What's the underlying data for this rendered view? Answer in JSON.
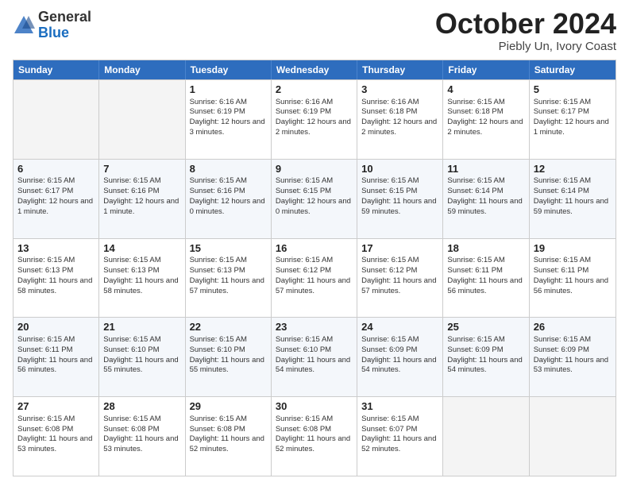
{
  "header": {
    "logo_line1": "General",
    "logo_line2": "Blue",
    "month": "October 2024",
    "location": "Piebly Un, Ivory Coast"
  },
  "days_of_week": [
    "Sunday",
    "Monday",
    "Tuesday",
    "Wednesday",
    "Thursday",
    "Friday",
    "Saturday"
  ],
  "weeks": [
    [
      {
        "day": "",
        "info": ""
      },
      {
        "day": "",
        "info": ""
      },
      {
        "day": "1",
        "info": "Sunrise: 6:16 AM\nSunset: 6:19 PM\nDaylight: 12 hours and 3 minutes."
      },
      {
        "day": "2",
        "info": "Sunrise: 6:16 AM\nSunset: 6:19 PM\nDaylight: 12 hours and 2 minutes."
      },
      {
        "day": "3",
        "info": "Sunrise: 6:16 AM\nSunset: 6:18 PM\nDaylight: 12 hours and 2 minutes."
      },
      {
        "day": "4",
        "info": "Sunrise: 6:15 AM\nSunset: 6:18 PM\nDaylight: 12 hours and 2 minutes."
      },
      {
        "day": "5",
        "info": "Sunrise: 6:15 AM\nSunset: 6:17 PM\nDaylight: 12 hours and 1 minute."
      }
    ],
    [
      {
        "day": "6",
        "info": "Sunrise: 6:15 AM\nSunset: 6:17 PM\nDaylight: 12 hours and 1 minute."
      },
      {
        "day": "7",
        "info": "Sunrise: 6:15 AM\nSunset: 6:16 PM\nDaylight: 12 hours and 1 minute."
      },
      {
        "day": "8",
        "info": "Sunrise: 6:15 AM\nSunset: 6:16 PM\nDaylight: 12 hours and 0 minutes."
      },
      {
        "day": "9",
        "info": "Sunrise: 6:15 AM\nSunset: 6:15 PM\nDaylight: 12 hours and 0 minutes."
      },
      {
        "day": "10",
        "info": "Sunrise: 6:15 AM\nSunset: 6:15 PM\nDaylight: 11 hours and 59 minutes."
      },
      {
        "day": "11",
        "info": "Sunrise: 6:15 AM\nSunset: 6:14 PM\nDaylight: 11 hours and 59 minutes."
      },
      {
        "day": "12",
        "info": "Sunrise: 6:15 AM\nSunset: 6:14 PM\nDaylight: 11 hours and 59 minutes."
      }
    ],
    [
      {
        "day": "13",
        "info": "Sunrise: 6:15 AM\nSunset: 6:13 PM\nDaylight: 11 hours and 58 minutes."
      },
      {
        "day": "14",
        "info": "Sunrise: 6:15 AM\nSunset: 6:13 PM\nDaylight: 11 hours and 58 minutes."
      },
      {
        "day": "15",
        "info": "Sunrise: 6:15 AM\nSunset: 6:13 PM\nDaylight: 11 hours and 57 minutes."
      },
      {
        "day": "16",
        "info": "Sunrise: 6:15 AM\nSunset: 6:12 PM\nDaylight: 11 hours and 57 minutes."
      },
      {
        "day": "17",
        "info": "Sunrise: 6:15 AM\nSunset: 6:12 PM\nDaylight: 11 hours and 57 minutes."
      },
      {
        "day": "18",
        "info": "Sunrise: 6:15 AM\nSunset: 6:11 PM\nDaylight: 11 hours and 56 minutes."
      },
      {
        "day": "19",
        "info": "Sunrise: 6:15 AM\nSunset: 6:11 PM\nDaylight: 11 hours and 56 minutes."
      }
    ],
    [
      {
        "day": "20",
        "info": "Sunrise: 6:15 AM\nSunset: 6:11 PM\nDaylight: 11 hours and 56 minutes."
      },
      {
        "day": "21",
        "info": "Sunrise: 6:15 AM\nSunset: 6:10 PM\nDaylight: 11 hours and 55 minutes."
      },
      {
        "day": "22",
        "info": "Sunrise: 6:15 AM\nSunset: 6:10 PM\nDaylight: 11 hours and 55 minutes."
      },
      {
        "day": "23",
        "info": "Sunrise: 6:15 AM\nSunset: 6:10 PM\nDaylight: 11 hours and 54 minutes."
      },
      {
        "day": "24",
        "info": "Sunrise: 6:15 AM\nSunset: 6:09 PM\nDaylight: 11 hours and 54 minutes."
      },
      {
        "day": "25",
        "info": "Sunrise: 6:15 AM\nSunset: 6:09 PM\nDaylight: 11 hours and 54 minutes."
      },
      {
        "day": "26",
        "info": "Sunrise: 6:15 AM\nSunset: 6:09 PM\nDaylight: 11 hours and 53 minutes."
      }
    ],
    [
      {
        "day": "27",
        "info": "Sunrise: 6:15 AM\nSunset: 6:08 PM\nDaylight: 11 hours and 53 minutes."
      },
      {
        "day": "28",
        "info": "Sunrise: 6:15 AM\nSunset: 6:08 PM\nDaylight: 11 hours and 53 minutes."
      },
      {
        "day": "29",
        "info": "Sunrise: 6:15 AM\nSunset: 6:08 PM\nDaylight: 11 hours and 52 minutes."
      },
      {
        "day": "30",
        "info": "Sunrise: 6:15 AM\nSunset: 6:08 PM\nDaylight: 11 hours and 52 minutes."
      },
      {
        "day": "31",
        "info": "Sunrise: 6:15 AM\nSunset: 6:07 PM\nDaylight: 11 hours and 52 minutes."
      },
      {
        "day": "",
        "info": ""
      },
      {
        "day": "",
        "info": ""
      }
    ]
  ]
}
